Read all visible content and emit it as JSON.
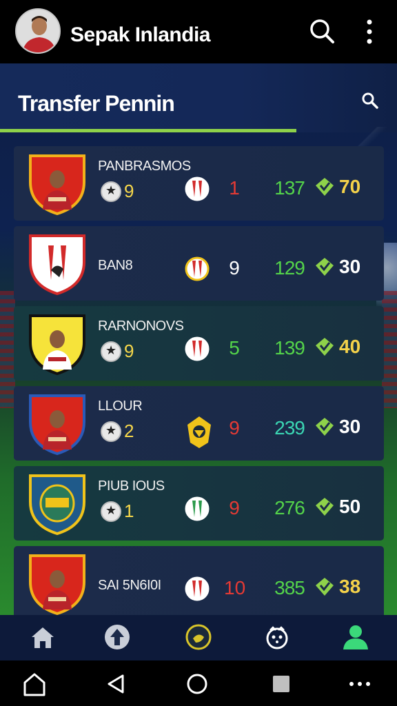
{
  "app": {
    "title": "Sepak Inlandia"
  },
  "section": {
    "title": "Transfer Pennin"
  },
  "players": [
    {
      "name": "PANBRASMOS",
      "rating": "9",
      "goals": "1",
      "goals_color": "#e53a34",
      "score": "137",
      "score_color": "green",
      "value": "70",
      "value_color": "#f4d24a",
      "crest_color": "#d8261c",
      "crest_rim": "#f2b11a",
      "club": "stripes-red"
    },
    {
      "name": "BAN8",
      "rating": "",
      "goals": "9",
      "goals_color": "#ffffff",
      "score": "129",
      "score_color": "green",
      "value": "30",
      "value_color": "#ffffff",
      "crest_color": "#ffffff",
      "crest_rim": "#d22a2a",
      "club": "stripes-gold"
    },
    {
      "name": "RARNONOVS",
      "rating": "9",
      "goals": "5",
      "goals_color": "#54d44a",
      "score": "139",
      "score_color": "green",
      "value": "40",
      "value_color": "#f4d24a",
      "crest_color": "#f6e33a",
      "crest_rim": "#111111",
      "club": "stripes-red"
    },
    {
      "name": "LLOUR",
      "rating": "2",
      "goals": "9",
      "goals_color": "#e53a34",
      "score": "239",
      "score_color": "teal",
      "value": "30",
      "value_color": "#ffffff",
      "crest_color": "#d8261c",
      "crest_rim": "#2b5ab8",
      "club": "eagle"
    },
    {
      "name": "PIUB IOUS",
      "rating": "1",
      "goals": "9",
      "goals_color": "#e53a34",
      "score": "276",
      "score_color": "green",
      "value": "50",
      "value_color": "#ffffff",
      "crest_color": "#1f5a8a",
      "crest_rim": "#f0c31a",
      "club": "stripes-green"
    },
    {
      "name": "SAI 5N6I0I",
      "rating": "",
      "goals": "10",
      "goals_color": "#e53a34",
      "score": "385",
      "score_color": "green",
      "value": "38",
      "value_color": "#f4d24a",
      "crest_color": "#d8261c",
      "crest_rim": "#f2b11a",
      "club": "stripes-red"
    }
  ],
  "icons": {
    "top": [
      "search-icon",
      "more-vertical-icon"
    ],
    "section": [
      "search-icon"
    ],
    "bottom_nav": [
      "home-icon",
      "upload-icon",
      "whistle-icon",
      "stats-icon",
      "profile-icon"
    ],
    "system": [
      "home-outline-icon",
      "back-icon",
      "circle-icon",
      "square-icon",
      "dots-icon"
    ]
  },
  "colors": {
    "accent_green": "#8ed24a",
    "active_nav": "#3bd97a",
    "top_bar": "#000000",
    "header": "#152a5a"
  }
}
